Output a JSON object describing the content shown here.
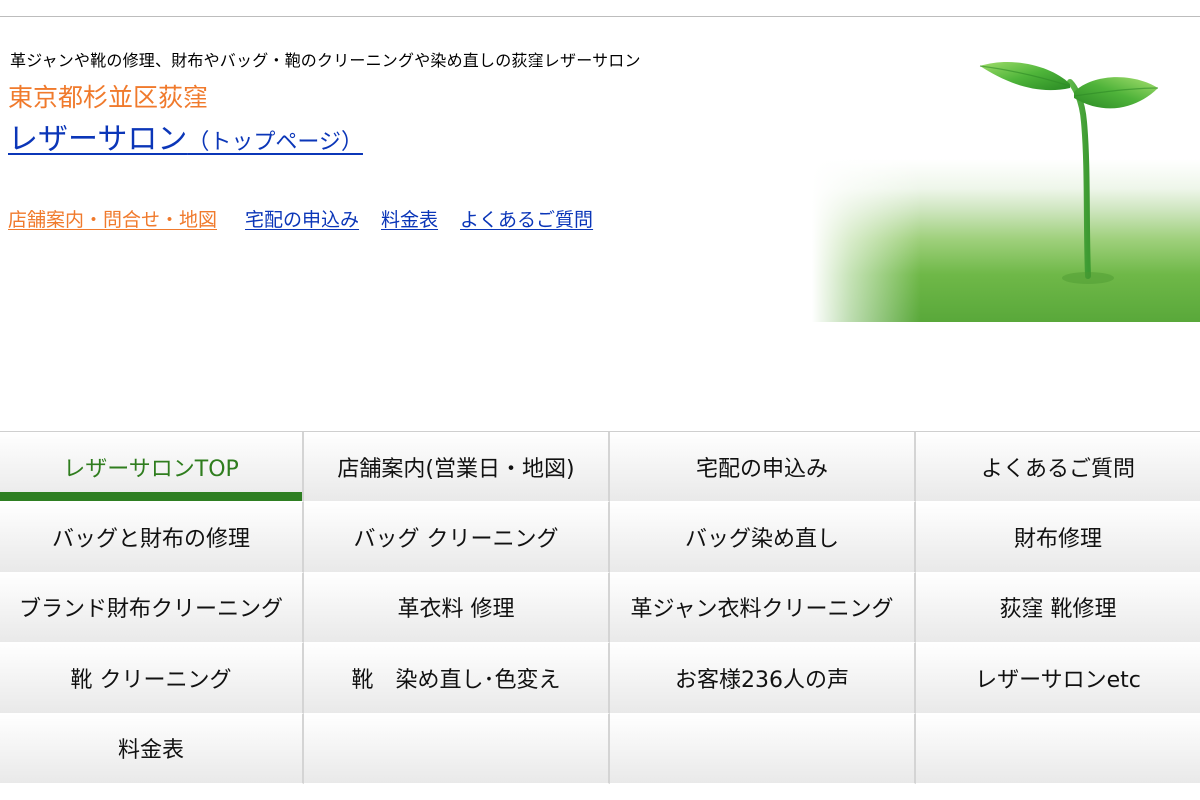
{
  "header": {
    "tagline": "革ジャンや靴の修理、財布やバッグ・鞄のクリーニングや染め直しの荻窪レザーサロン",
    "location": "東京都杉並区荻窪",
    "site_title_main": "レザーサロン",
    "site_title_sub": "（トップページ）"
  },
  "quicklinks": [
    {
      "label": "店舗案内・問合せ・地図"
    },
    {
      "label": "宅配の申込み"
    },
    {
      "label": "料金表"
    },
    {
      "label": "よくあるご質問"
    }
  ],
  "colors": {
    "accent_orange": "#f07a2c",
    "link_blue": "#0b36b8",
    "active_green": "#2e7f22"
  },
  "hero": {
    "icon": "sprout-on-grass-image"
  },
  "nav": {
    "items": [
      {
        "label": "レザーサロンTOP",
        "active": true
      },
      {
        "label": "店舗案内(営業日・地図)"
      },
      {
        "label": "宅配の申込み"
      },
      {
        "label": "よくあるご質問"
      },
      {
        "label": "バッグと財布の修理"
      },
      {
        "label": "バッグ クリーニング"
      },
      {
        "label": "バッグ染め直し"
      },
      {
        "label": "財布修理"
      },
      {
        "label": "ブランド財布クリーニング"
      },
      {
        "label": "革衣料 修理"
      },
      {
        "label": "革ジャン衣料クリーニング"
      },
      {
        "label": "荻窪 靴修理"
      },
      {
        "label": "靴 クリーニング"
      },
      {
        "label": "靴　染め直し･色変え"
      },
      {
        "label": "お客様236人の声"
      },
      {
        "label": "レザーサロンetc"
      },
      {
        "label": "料金表"
      },
      {
        "label": ""
      },
      {
        "label": ""
      },
      {
        "label": ""
      }
    ]
  }
}
